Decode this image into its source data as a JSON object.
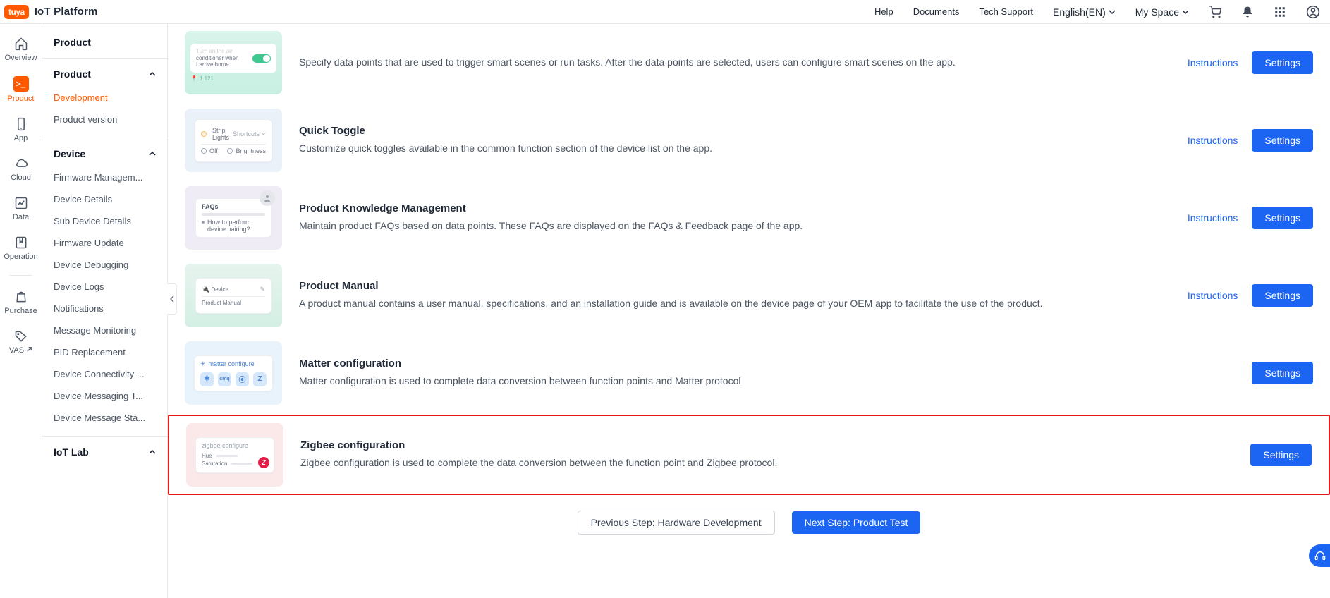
{
  "brand": {
    "logo": "tuya",
    "title": "IoT Platform"
  },
  "topnav": {
    "help": "Help",
    "documents": "Documents",
    "tech_support": "Tech Support",
    "language": "English(EN)",
    "my_space": "My Space"
  },
  "rail": {
    "overview": "Overview",
    "product": "Product",
    "app": "App",
    "cloud": "Cloud",
    "data": "Data",
    "operation": "Operation",
    "purchase": "Purchase",
    "vas": "VAS"
  },
  "sidebar": {
    "title": "Product",
    "product_group": "Product",
    "items_product": [
      "Development",
      "Product version"
    ],
    "device_group": "Device",
    "items_device": [
      "Firmware Managem...",
      "Device Details",
      "Sub Device Details",
      "Firmware Update",
      "Device Debugging",
      "Device Logs",
      "Notifications",
      "Message Monitoring",
      "PID Replacement",
      "Device Connectivity ...",
      "Device Messaging T...",
      "Device Message Sta..."
    ],
    "iotlab_group": "IoT Lab"
  },
  "rows": [
    {
      "thumb": "t1",
      "title": "",
      "desc": "Specify data points that are used to trigger smart scenes or run tasks. After the data points are selected, users can configure smart scenes on the app.",
      "instructions": "Instructions",
      "settings": "Settings",
      "thumb_text": {
        "a": "Turn on the air",
        "b": "conditioner when",
        "c": "I arrive home",
        "d": "1.121"
      }
    },
    {
      "thumb": "t2",
      "title": "Quick Toggle",
      "desc": "Customize quick toggles available in the common function section of the device list on the app.",
      "instructions": "Instructions",
      "settings": "Settings",
      "thumb_text": {
        "a": "Strip",
        "b": "Lights",
        "c": "Shortcuts",
        "d": "Off",
        "e": "Brightness"
      }
    },
    {
      "thumb": "t3",
      "title": "Product Knowledge Management",
      "desc": "Maintain product FAQs based on data points. These FAQs are displayed on the FAQs & Feedback page of the app.",
      "instructions": "Instructions",
      "settings": "Settings",
      "thumb_text": {
        "a": "FAQs",
        "b": "How to perform",
        "c": "device pairing?"
      }
    },
    {
      "thumb": "t4",
      "title": "Product Manual",
      "desc": "A product manual contains a user manual, specifications, and an installation guide and is available on the device page of your OEM app to facilitate the use of the product.",
      "instructions": "Instructions",
      "settings": "Settings",
      "thumb_text": {
        "a": "Device",
        "b": "Product Manual"
      }
    },
    {
      "thumb": "t5",
      "title": "Matter configuration",
      "desc": "Matter configuration is used to complete data conversion between function points and Matter protocol",
      "instructions": null,
      "settings": "Settings",
      "thumb_text": {
        "a": "matter configure"
      }
    },
    {
      "thumb": "t6",
      "title": "Zigbee configuration",
      "desc": "Zigbee configuration is used to complete the data conversion between the function point and Zigbee protocol.",
      "instructions": null,
      "settings": "Settings",
      "highlighted": true,
      "thumb_text": {
        "a": "zigbee configure",
        "b": "Hue",
        "c": "Saturation"
      }
    }
  ],
  "footer": {
    "prev": "Previous Step: Hardware Development",
    "next": "Next Step: Product Test"
  }
}
